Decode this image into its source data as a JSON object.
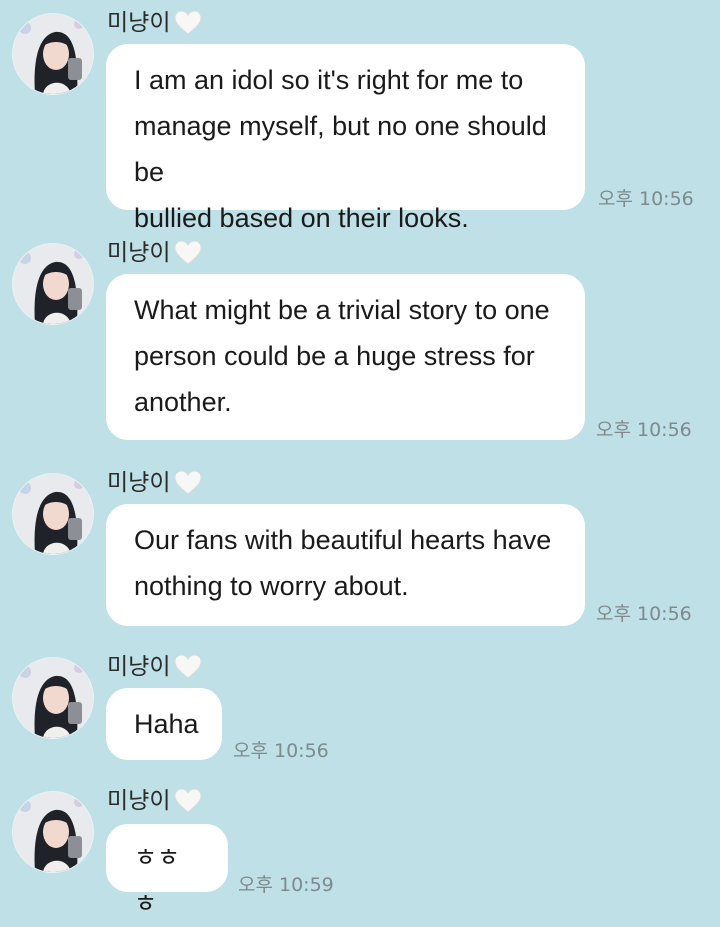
{
  "sender": {
    "name": "미냥이",
    "name_icon": "white-heart-icon",
    "avatar": "profile-photo"
  },
  "messages": [
    {
      "lines": [
        "I am an idol so it's right for me to",
        "manage myself, but no one should be",
        "bullied based on their looks."
      ],
      "time": "오후 10:56"
    },
    {
      "lines": [
        "What might be a trivial story to one",
        "person could be a huge stress for",
        "another."
      ],
      "time": "오후 10:56"
    },
    {
      "lines": [
        "Our fans with beautiful hearts have",
        "nothing to worry about."
      ],
      "time": "오후 10:56"
    },
    {
      "lines": [
        "Haha"
      ],
      "time": "오후 10:56"
    },
    {
      "lines": [
        "ㅎㅎㅎ"
      ],
      "time": "오후 10:59"
    }
  ],
  "colors": {
    "background": "#bfe0e6",
    "bubble": "#ffffff",
    "timestamp": "#7d8a8e"
  }
}
